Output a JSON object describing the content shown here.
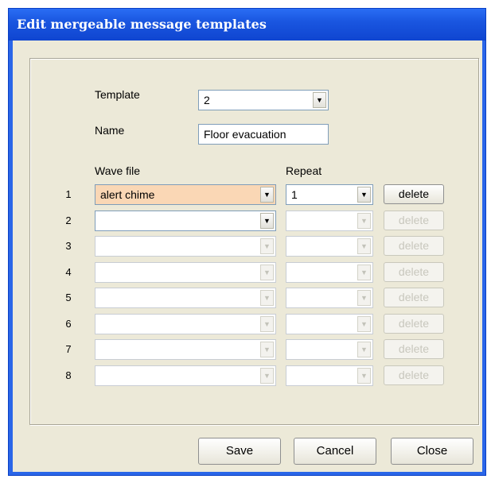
{
  "window": {
    "title": "Edit mergeable message templates"
  },
  "form": {
    "template_label": "Template",
    "template_value": "2",
    "name_label": "Name",
    "name_value": "Floor evacuation",
    "wave_file_header": "Wave file",
    "repeat_header": "Repeat"
  },
  "rows": [
    {
      "num": "1",
      "wave": "alert chime",
      "repeat": "1",
      "delete_label": "delete"
    },
    {
      "num": "2",
      "wave": "",
      "repeat": "",
      "delete_label": "delete"
    },
    {
      "num": "3",
      "wave": "",
      "repeat": "",
      "delete_label": "delete"
    },
    {
      "num": "4",
      "wave": "",
      "repeat": "",
      "delete_label": "delete"
    },
    {
      "num": "5",
      "wave": "",
      "repeat": "",
      "delete_label": "delete"
    },
    {
      "num": "6",
      "wave": "",
      "repeat": "",
      "delete_label": "delete"
    },
    {
      "num": "7",
      "wave": "",
      "repeat": "",
      "delete_label": "delete"
    },
    {
      "num": "8",
      "wave": "",
      "repeat": "",
      "delete_label": "delete"
    }
  ],
  "buttons": {
    "save": "Save",
    "cancel": "Cancel",
    "close": "Close"
  },
  "colors": {
    "title_bar": "#1a56e0",
    "active_row": "#fad7b5",
    "dialog_bg": "#ece9d8"
  }
}
